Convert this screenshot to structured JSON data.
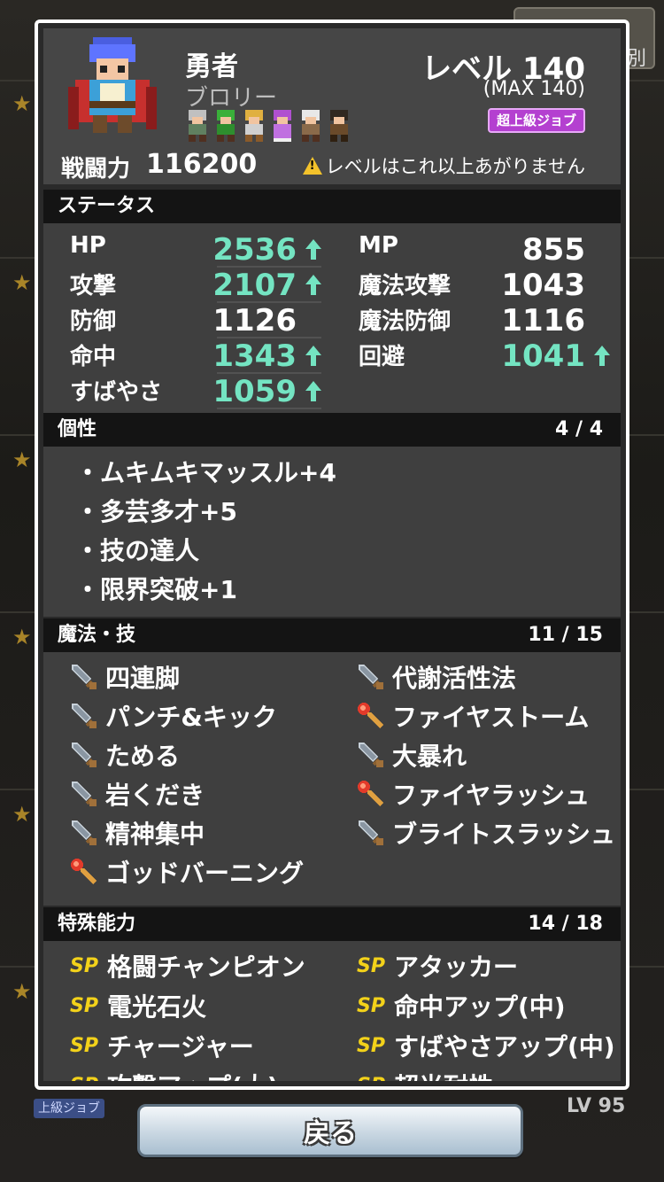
{
  "background": {
    "top_tab_label": "別",
    "bottom_job_label": "上級ジョブ",
    "bottom_level": "LV 95"
  },
  "hero": {
    "name": "勇者",
    "player_name": "ブロリー",
    "level_label": "レベル 140",
    "level_max": "(MAX 140)",
    "job_badge": "超上級ジョブ",
    "power_label": "戦闘力",
    "power_value": "116200",
    "level_warning": "レベルはこれ以上あがりません"
  },
  "status": {
    "header": "ステータス",
    "left": [
      {
        "name": "HP",
        "value": "2536",
        "up": true
      },
      {
        "name": "攻撃",
        "value": "2107",
        "up": true
      },
      {
        "name": "防御",
        "value": "1126",
        "up": false
      },
      {
        "name": "命中",
        "value": "1343",
        "up": true
      },
      {
        "name": "すばやさ",
        "value": "1059",
        "up": true
      }
    ],
    "right": [
      {
        "name": "MP",
        "value": "855",
        "up": false
      },
      {
        "name": "魔法攻撃",
        "value": "1043",
        "up": false
      },
      {
        "name": "魔法防御",
        "value": "1116",
        "up": false
      },
      {
        "name": "回避",
        "value": "1041",
        "up": true
      }
    ]
  },
  "traits": {
    "header": "個性",
    "count": "4 / 4",
    "items": [
      "・ムキムキマッスル+4",
      "・多芸多才+5",
      "・技の達人",
      "・限界突破+1"
    ]
  },
  "skills": {
    "header": "魔法・技",
    "count": "11 / 15",
    "left": [
      {
        "label": "四連脚",
        "icon": "sword"
      },
      {
        "label": "パンチ&キック",
        "icon": "sword"
      },
      {
        "label": "ためる",
        "icon": "sword"
      },
      {
        "label": "岩くだき",
        "icon": "sword"
      },
      {
        "label": "精神集中",
        "icon": "sword"
      },
      {
        "label": "ゴッドバーニング",
        "icon": "torch"
      }
    ],
    "right": [
      {
        "label": "代謝活性法",
        "icon": "sword"
      },
      {
        "label": "ファイヤストーム",
        "icon": "torch"
      },
      {
        "label": "大暴れ",
        "icon": "sword"
      },
      {
        "label": "ファイヤラッシュ",
        "icon": "torch"
      },
      {
        "label": "ブライトスラッシュ",
        "icon": "sword"
      }
    ]
  },
  "abilities": {
    "header": "特殊能力",
    "count": "14 / 18",
    "sp_label": "SP",
    "left": [
      "格闘チャンピオン",
      "電光石火",
      "チャージャー",
      "攻撃アップ(大)"
    ],
    "right": [
      "アタッカー",
      "命中アップ(中)",
      "すばやさアップ(中)",
      "超光耐性"
    ]
  },
  "footer": {
    "back_label": "戻る"
  },
  "colors": {
    "stat_up": "#74e4c2",
    "sp": "#f3d21a",
    "job_badge": "#b440d0"
  }
}
